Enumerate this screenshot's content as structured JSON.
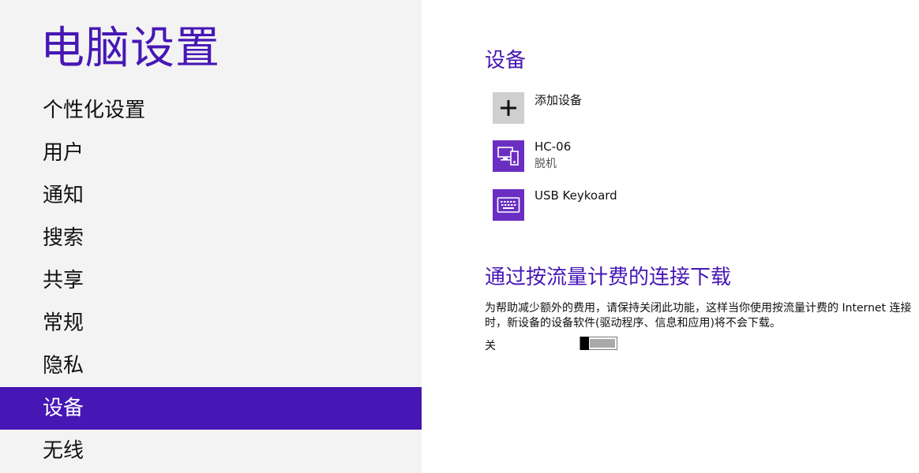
{
  "app": {
    "title": "电脑设置"
  },
  "sidebar": {
    "items": [
      {
        "label": "个性化设置",
        "selected": false
      },
      {
        "label": "用户",
        "selected": false
      },
      {
        "label": "通知",
        "selected": false
      },
      {
        "label": "搜索",
        "selected": false
      },
      {
        "label": "共享",
        "selected": false
      },
      {
        "label": "常规",
        "selected": false
      },
      {
        "label": "隐私",
        "selected": false
      },
      {
        "label": "设备",
        "selected": true
      },
      {
        "label": "无线",
        "selected": false
      }
    ]
  },
  "main": {
    "devices_title": "设备",
    "devices": [
      {
        "name": "添加设备",
        "status": "",
        "icon": "plus-icon"
      },
      {
        "name": "HC-06",
        "status": "脱机",
        "icon": "pc-phone-icon"
      },
      {
        "name": "USB Keykoard",
        "status": "",
        "icon": "keyboard-icon"
      }
    ],
    "metered": {
      "title": "通过按流量计费的连接下载",
      "description": "为帮助减少额外的费用，请保持关闭此功能，这样当你使用按流量计费的 Internet 连接时，新设备的设备软件(驱动程序、信息和应用)将不会下载。",
      "toggle_label": "关",
      "toggle_on": false
    }
  },
  "colors": {
    "accent": "#4617b4",
    "tile_purple": "#6a2fc2",
    "add_tile": "#cfcfcf",
    "sidebar_bg": "#f3f3f3"
  }
}
